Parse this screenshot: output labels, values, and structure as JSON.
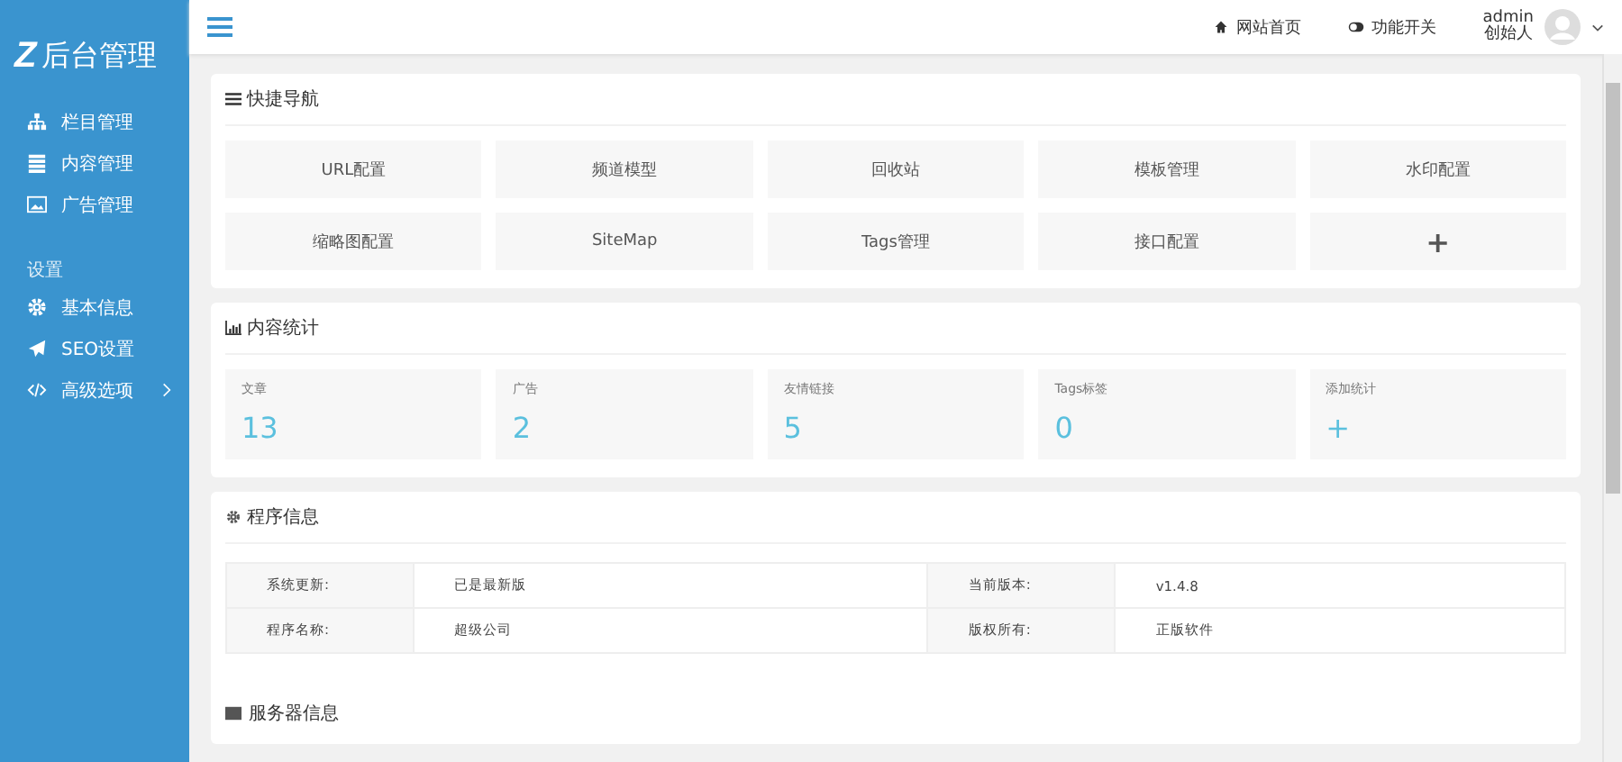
{
  "logo": {
    "mark": "Z",
    "title": "后台管理"
  },
  "sidebar": {
    "items": [
      {
        "label": "栏目管理",
        "kind": "sitemap",
        "expandable": false
      },
      {
        "label": "内容管理",
        "kind": "list",
        "expandable": false
      },
      {
        "label": "广告管理",
        "kind": "image",
        "expandable": false
      }
    ],
    "section": "设置",
    "settings": [
      {
        "label": "基本信息",
        "kind": "gear",
        "expandable": false
      },
      {
        "label": "SEO设置",
        "kind": "plane",
        "expandable": false
      },
      {
        "label": "高级选项",
        "kind": "code",
        "expandable": true
      }
    ]
  },
  "topbar": {
    "links": [
      {
        "label": "网站首页",
        "kind": "home"
      },
      {
        "label": "功能开关",
        "kind": "toggle"
      }
    ],
    "user": {
      "name": "admin",
      "role": "创始人"
    }
  },
  "quick_nav": {
    "title": "快捷导航",
    "items": [
      {
        "label": "URL配置"
      },
      {
        "label": "频道模型"
      },
      {
        "label": "回收站"
      },
      {
        "label": "模板管理"
      },
      {
        "label": "水印配置"
      },
      {
        "label": "缩略图配置"
      },
      {
        "label": "SiteMap"
      },
      {
        "label": "Tags管理"
      },
      {
        "label": "接口配置"
      },
      {
        "label": "+",
        "kind": "add"
      }
    ]
  },
  "stats": {
    "title": "内容统计",
    "items": [
      {
        "label": "文章",
        "value": "13"
      },
      {
        "label": "广告",
        "value": "2"
      },
      {
        "label": "友情链接",
        "value": "5"
      },
      {
        "label": "Tags标签",
        "value": "0"
      },
      {
        "label": "添加统计",
        "value": "+"
      }
    ]
  },
  "program_info": {
    "title": "程序信息",
    "rows": [
      [
        {
          "label": "系统更新:",
          "value": "已是最新版"
        },
        {
          "label": "当前版本:",
          "value": "v1.4.8"
        }
      ],
      [
        {
          "label": "程序名称:",
          "value": "超级公司"
        },
        {
          "label": "版权所有:",
          "value": "正版软件"
        }
      ]
    ]
  },
  "server_info": {
    "title": "服务器信息"
  }
}
